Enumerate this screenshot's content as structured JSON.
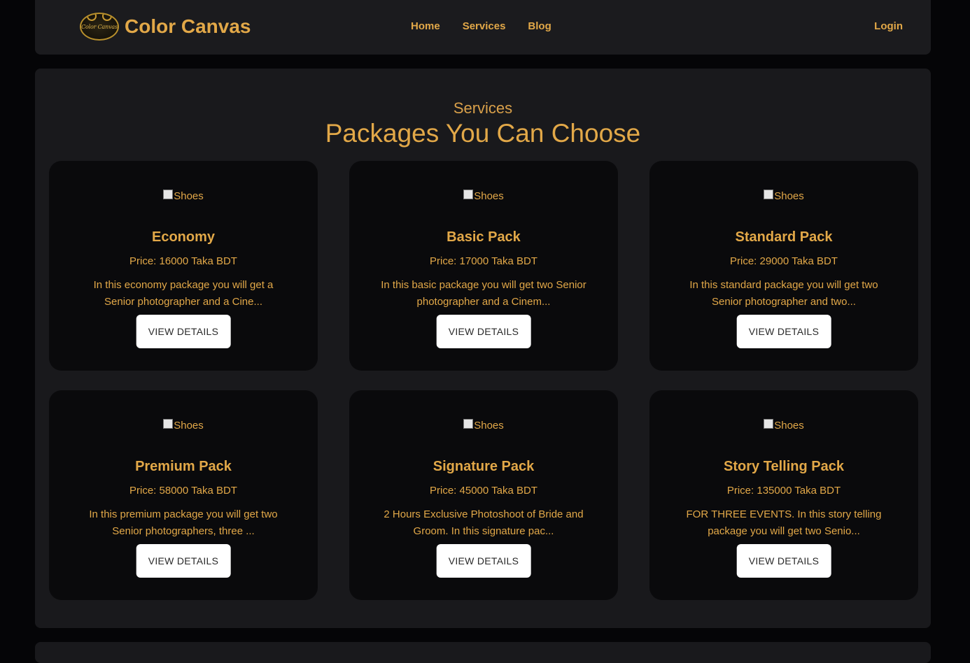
{
  "nav": {
    "logo_text": "Color Canvas",
    "brand": "Color Canvas",
    "links": [
      "Home",
      "Services",
      "Blog"
    ],
    "login": "Login"
  },
  "section": {
    "subtitle": "Services",
    "heading": "Packages You Can Choose"
  },
  "packages": [
    {
      "image_alt": "Shoes",
      "title": "Economy",
      "price": "Price: 16000 Taka BDT",
      "description": "In this economy package you will get a Senior photographer and a Cine...",
      "button": "VIEW DETAILS"
    },
    {
      "image_alt": "Shoes",
      "title": "Basic Pack",
      "price": "Price: 17000 Taka BDT",
      "description": "In this basic package you will get two Senior photographer and a Cinem...",
      "button": "VIEW DETAILS"
    },
    {
      "image_alt": "Shoes",
      "title": "Standard Pack",
      "price": "Price: 29000 Taka BDT",
      "description": "In this standard package you will get two Senior photographer and two...",
      "button": "VIEW DETAILS"
    },
    {
      "image_alt": "Shoes",
      "title": "Premium Pack",
      "price": "Price: 58000 Taka BDT",
      "description": "In this premium package you will get two Senior photographers, three ...",
      "button": "VIEW DETAILS"
    },
    {
      "image_alt": "Shoes",
      "title": "Signature Pack",
      "price": "Price: 45000 Taka BDT",
      "description": "2 Hours Exclusive Photoshoot of Bride and Groom. In this signature pac...",
      "button": "VIEW DETAILS"
    },
    {
      "image_alt": "Shoes",
      "title": "Story Telling Pack",
      "price": "Price: 135000 Taka BDT",
      "description": "FOR THREE EVENTS. In this story telling package you will get two Senio...",
      "button": "VIEW DETAILS"
    }
  ],
  "colors": {
    "accent": "#e2a848",
    "page_bg": "#050507",
    "panel_bg": "#19191c",
    "card_bg": "#0a0a0c",
    "button_bg": "#ffffff"
  }
}
